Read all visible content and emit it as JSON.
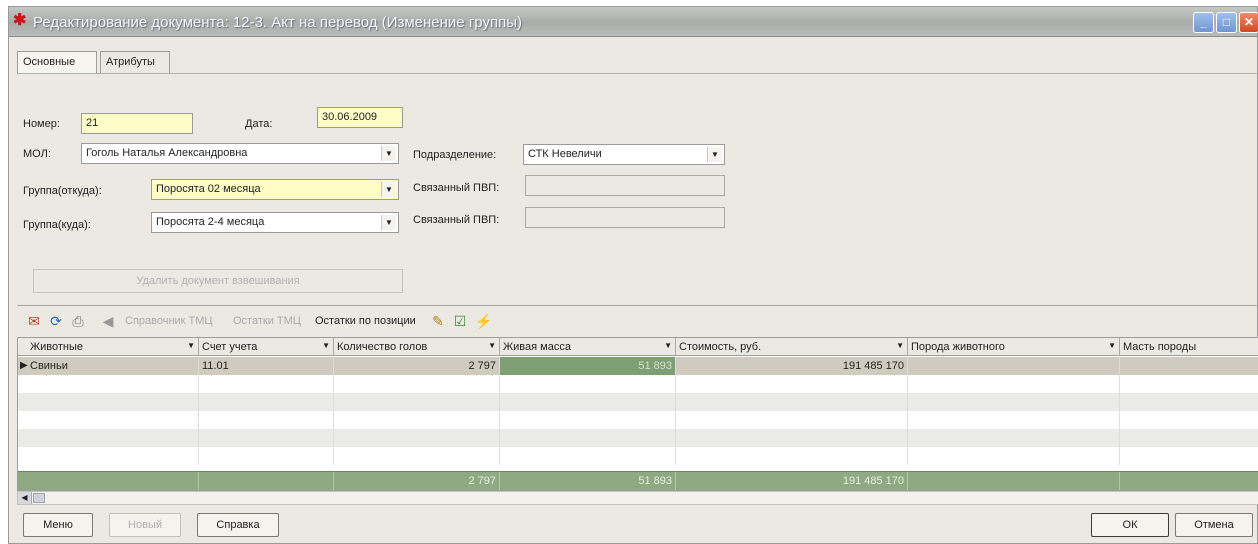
{
  "window": {
    "title": "Редактирование документа: 12-3. Акт на перевод (Изменение группы)",
    "icon": "app-logo-icon"
  },
  "tabs": [
    {
      "label": "Основные"
    },
    {
      "label": "Атрибуты"
    }
  ],
  "form": {
    "number_label": "Номер:",
    "number_value": "21",
    "date_label": "Дата:",
    "date_value": "30.06.2009",
    "mol_label": "МОЛ:",
    "mol_value": "Гоголь Наталья Александровна",
    "division_label": "Подразделение:",
    "division_value": "СТК Невеличи",
    "group_from_label": "Группа(откуда):",
    "group_from_value": "Поросята 02 месяца",
    "group_to_label": "Группа(куда):",
    "group_to_value": "Поросята 2-4 месяца",
    "linked_pvp_label_1": "Связанный ПВП:",
    "linked_pvp_value_1": "",
    "linked_pvp_label_2": "Связанный ПВП:",
    "linked_pvp_value_2": "",
    "delete_weighing_label": "Удалить документ взвешивания"
  },
  "toolbar": {
    "tmc_reference": "Справочник ТМЦ",
    "tmc_balances": "Остатки ТМЦ",
    "position_balances": "Остатки по позиции"
  },
  "grid": {
    "columns": [
      "Животные",
      "Счет учета",
      "Количество голов",
      "Живая масса",
      "Стоимость, руб.",
      "Порода животного",
      "Масть породы"
    ],
    "rows": [
      [
        "Свиньи",
        "11.01",
        "2 797",
        "51 893",
        "191 485 170",
        "",
        ""
      ]
    ],
    "totals": [
      "",
      "",
      "2 797",
      "51 893",
      "191 485 170",
      "",
      ""
    ]
  },
  "buttons": {
    "menu": "Меню",
    "new": "Новый",
    "help": "Справка",
    "ok": "ОК",
    "cancel": "Отмена"
  },
  "colors": {
    "accent_selected_cell": "#7e9e73",
    "totals_row": "#8fa982",
    "required_field": "#fdfcc7"
  }
}
